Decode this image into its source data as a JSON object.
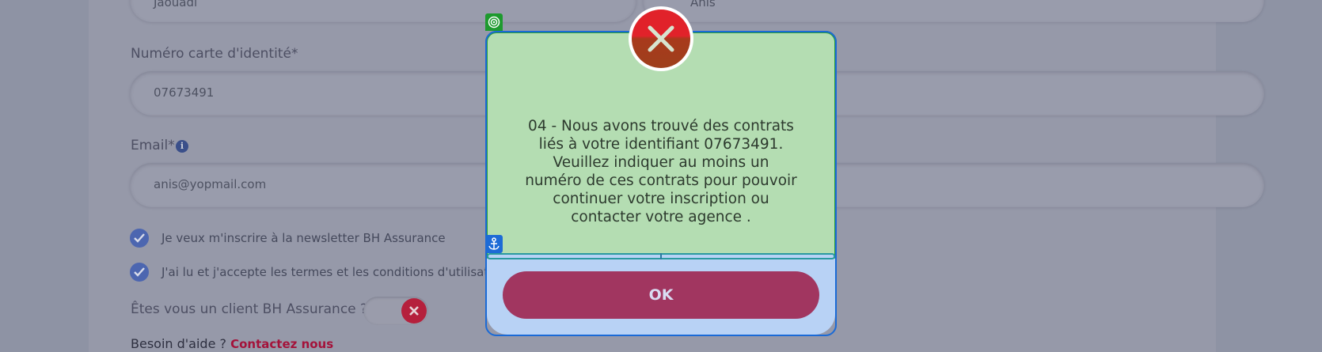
{
  "form": {
    "last_name_value": "Jaouadi",
    "first_name_value": "Anis",
    "id_card": {
      "label": "Numéro carte d'identité*",
      "value": "07673491"
    },
    "email": {
      "label": "Email*",
      "info_icon": "i",
      "value": "anis@yopmail.com"
    },
    "newsletter_label": "Je veux m'inscrire à la newsletter BH Assurance",
    "terms_label": "J'ai lu et j'accepte les termes et les conditions d'utilisation",
    "client_question": "Êtes vous un client BH Assurance ?*",
    "help_text": "Besoin d'aide ?",
    "help_link": "Contactez nous"
  },
  "modal": {
    "message": "04 - Nous avons trouvé des contrats liés à votre identifiant 07673491. Veuillez indiquer au moins un numéro de ces contrats pour pouvoir continuer votre inscription ou contacter votre agence .",
    "ok_label": "OK",
    "icons": {
      "close": "close-icon",
      "target": "target-icon",
      "anchor": "anchor-icon"
    }
  },
  "colors": {
    "overlay": "#8e93a4",
    "modal_top": "#b4ddb2",
    "modal_bottom": "#b8d2f5",
    "ok_button": "#a13660",
    "close_red": "#e1222a",
    "link_red": "#a4123a"
  }
}
